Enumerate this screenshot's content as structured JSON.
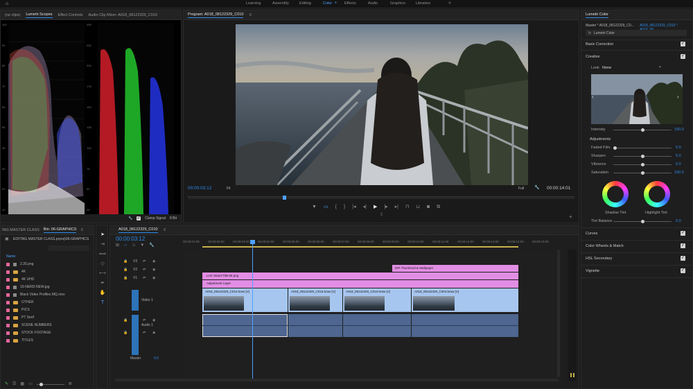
{
  "workspaces": [
    "Learning",
    "Assembly",
    "Editing",
    "Color",
    "Effects",
    "Audio",
    "Graphics",
    "Libraries"
  ],
  "active_workspace": "Color",
  "scopes_panel": {
    "tabs": [
      "(no clips)",
      "Lumetri Scopes",
      "Effect Controls",
      "Audio Clip Mixer: A018_08122329_C010"
    ],
    "axis_left": [
      "100",
      "90",
      "80",
      "70",
      "60",
      "50",
      "40",
      "30",
      "20",
      "10"
    ],
    "axis_right": [
      "255",
      "230",
      "204",
      "178",
      "153",
      "128",
      "102",
      "76",
      "51",
      "26"
    ],
    "clamp_signal": "Clamp Signal",
    "bit_depth": "8 Bit"
  },
  "program_monitor": {
    "title": "Program: A018_08122329_C010",
    "timecode_left": "00:00:03:12",
    "fit": "Fit",
    "quality": "Full",
    "timecode_right": "00:00:14:01"
  },
  "lumetri": {
    "panel_title": "Lumetri Color",
    "master_label": "Master * A018_08122329_C0...",
    "clip_label": "A018_08122329_C010 * A018_08...",
    "effect_name": "Lumetri Color",
    "basic_correction": "Basic Correction",
    "creative": "Creative",
    "look_label": "Look",
    "look_value": "None",
    "intensity_label": "Intensity",
    "intensity_value": "100.0",
    "adjustments": "Adjustments",
    "faded_film_label": "Faded Film",
    "faded_film_value": "0.0",
    "sharpen_label": "Sharpen",
    "sharpen_value": "0.0",
    "vibrance_label": "Vibrance",
    "vibrance_value": "0.0",
    "saturation_label": "Saturation",
    "saturation_value": "100.0",
    "shadow_tint": "Shadow Tint",
    "highlight_tint": "Highlight Tint",
    "tint_balance_label": "Tint Balance",
    "tint_balance_value": "0.0",
    "curves": "Curves",
    "color_wheels": "Color Wheels & Match",
    "hsl_secondary": "HSL Secondary",
    "vignette": "Vignette"
  },
  "project_panel": {
    "tabs": [
      "ING MASTER CLASS",
      "Bin: 06-GRAPHICS"
    ],
    "path": "EDITING MASTER CLASS.prproj\\06-GRAPHICS",
    "column_header": "Name",
    "items": [
      {
        "name": "2.35.png",
        "color": "#e3669a",
        "type": "file"
      },
      {
        "name": "4K",
        "color": "#e3669a",
        "type": "folder"
      },
      {
        "name": "4K UHD",
        "color": "#e3669a",
        "type": "folder"
      },
      {
        "name": "16-NERD-NEW.jpg",
        "color": "#e3669a",
        "type": "file"
      },
      {
        "name": "Black Video Profiles MQ.mov",
        "color": "#e3669a",
        "type": "file"
      },
      {
        "name": "OTHER",
        "color": "#e3669a",
        "type": "folder"
      },
      {
        "name": "PICS",
        "color": "#e3669a",
        "type": "folder"
      },
      {
        "name": "PT Serif",
        "color": "#e3669a",
        "type": "folder"
      },
      {
        "name": "SCENE NUMBERS",
        "color": "#e3669a",
        "type": "folder"
      },
      {
        "name": "STOCK FOOTAGE",
        "color": "#e3669a",
        "type": "folder"
      },
      {
        "name": "TITLES",
        "color": "#e3669a",
        "type": "folder"
      }
    ]
  },
  "timeline": {
    "sequence_tab": "A018_08122329_C010",
    "timecode": "00:00:03:12",
    "ruler": [
      "00:00:01:00",
      "00:00:02:00",
      "00:00:03:00",
      "00:00:04:00",
      "00:00:05:00",
      "00:00:06:00",
      "00:00:07:00",
      "00:00:08:00",
      "00:00:09:00",
      "00:00:10:00",
      "00:00:11:00",
      "00:00:12:00",
      "00:00:13:00",
      "00:00:14:00",
      "00:00:15:00"
    ],
    "video_tracks": [
      "V3",
      "V2",
      "V1"
    ],
    "video1_name": "Video 1",
    "audio_tracks": [
      "A1",
      "A2"
    ],
    "audio1_name": "Audio 1",
    "master_label": "Master",
    "master_value": "0.0",
    "clips": {
      "title_v4": "DIP Thumbnail & Wallpaper",
      "graphic_v3": "LUX Stand-Title-BI.png",
      "adjustment": "Adjustment Layer",
      "v1_clip1": "A018_08122329_C010.braw [V]",
      "v1_clip2": "A018_08122329_C015.braw [V]",
      "v1_clip3": "A018_08122329_C010.braw [V]",
      "v1_clip4": "A018_08122329_C004.braw [V]"
    },
    "colors": {
      "pink": "#e28de4",
      "blue": "#a7c6ef",
      "audio": "#4e6690",
      "playhead": "#4ea1ff"
    }
  }
}
